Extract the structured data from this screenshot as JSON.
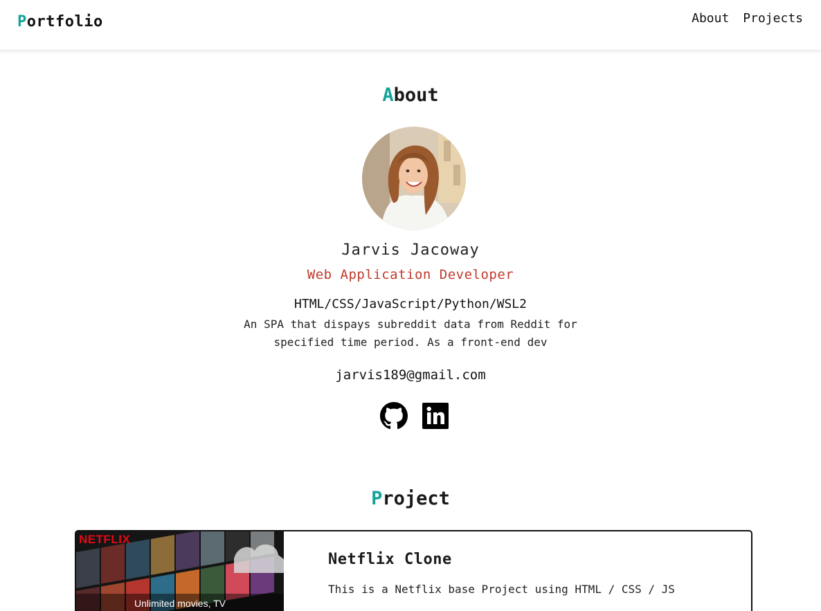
{
  "navbar": {
    "brand_first": "P",
    "brand_rest": "ortfolio",
    "links": [
      {
        "label": "About"
      },
      {
        "label": "Projects"
      }
    ]
  },
  "about": {
    "title_first": "A",
    "title_rest": "bout",
    "avatar_icon": "profile-photo",
    "name": "Jarvis Jacoway",
    "role": "Web Application Developer",
    "stack": "HTML/CSS/JavaScript/Python/WSL2",
    "description": "An SPA that dispays subreddit data from Reddit for specified time period. As a front-end dev",
    "email": "jarvis189@gmail.com",
    "socials": [
      {
        "icon": "github-icon"
      },
      {
        "icon": "linkedin-icon"
      }
    ]
  },
  "project_section": {
    "title_first": "P",
    "title_rest": "roject",
    "projects": [
      {
        "thumbnail_logo": "NETFLIX",
        "thumbnail_caption": "Unlimited movies, TV",
        "name": "Netflix Clone",
        "description": "This is a Netflix base Project using HTML / CSS / JS"
      }
    ]
  },
  "colors": {
    "accent": "#14a39a",
    "role": "#c0392b",
    "netflix_red": "#e50914"
  }
}
